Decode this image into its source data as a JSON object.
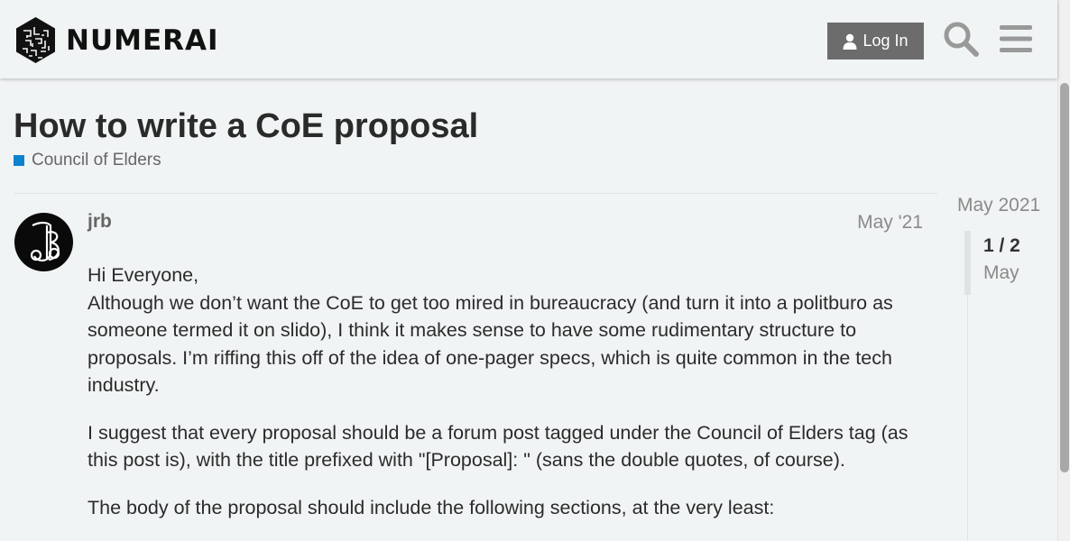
{
  "header": {
    "logo_text": "NUMERAI",
    "login_label": "Log In",
    "icons": [
      "user-icon",
      "search-icon",
      "hamburger-menu-icon"
    ],
    "colors": {
      "login_bg": "#6c6c6c",
      "background": "#f1f4f5"
    }
  },
  "topic": {
    "title": "How to write a CoE proposal",
    "category": "Council of Elders",
    "category_color": "#0e83cd"
  },
  "post": {
    "username": "jrb",
    "date": "May '21",
    "paragraphs": [
      "Hi Everyone,",
      "Although we don’t want the CoE to get too mired in bureaucracy (and turn it into a politburo as someone termed it on slido), I think it makes sense to have some rudimentary structure to proposals. I’m riffing this off of the idea of one-pager specs, which is quite common in the tech industry.",
      "I suggest that every proposal should be a forum post tagged under the Council of Elders tag (as this post is), with the title prefixed with \"[Proposal]: \" (sans the double quotes, of course).",
      "The body of the proposal should include the following sections, at the very least:"
    ]
  },
  "timeline": {
    "start_label": "May 2021",
    "position": "1 / 2",
    "current_label": "May"
  }
}
